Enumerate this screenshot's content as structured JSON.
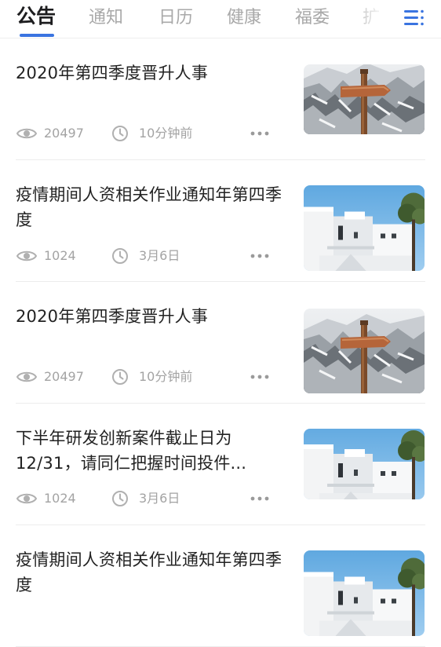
{
  "tabs": [
    {
      "label": "公告",
      "active": true
    },
    {
      "label": "通知",
      "active": false
    },
    {
      "label": "日历",
      "active": false
    },
    {
      "label": "健康",
      "active": false
    },
    {
      "label": "福委",
      "active": false
    },
    {
      "label": "扩",
      "active": false
    }
  ],
  "menu_icon": "menu-list-icon",
  "colors": {
    "accent": "#3a74e0",
    "meta": "#a3a3a3",
    "title": "#222222"
  },
  "articles": [
    {
      "title": "2020年第四季度晋升人事",
      "views": "20497",
      "time": "10分钟前",
      "thumbnail": "signpost-snow-image"
    },
    {
      "title": "疫情期间人资相关作业通知年第四季度",
      "views": "1024",
      "time": "3月6日",
      "thumbnail": "white-building-image"
    },
    {
      "title": "2020年第四季度晋升人事",
      "views": "20497",
      "time": "10分钟前",
      "thumbnail": "signpost-snow-image"
    },
    {
      "title": "下半年研发创新案件截止日为12/31，请同仁把握时间投件...",
      "views": "1024",
      "time": "3月6日",
      "thumbnail": "white-building-image"
    },
    {
      "title": "疫情期间人资相关作业通知年第四季度",
      "views": "",
      "time": "",
      "thumbnail": "white-building-image"
    }
  ]
}
